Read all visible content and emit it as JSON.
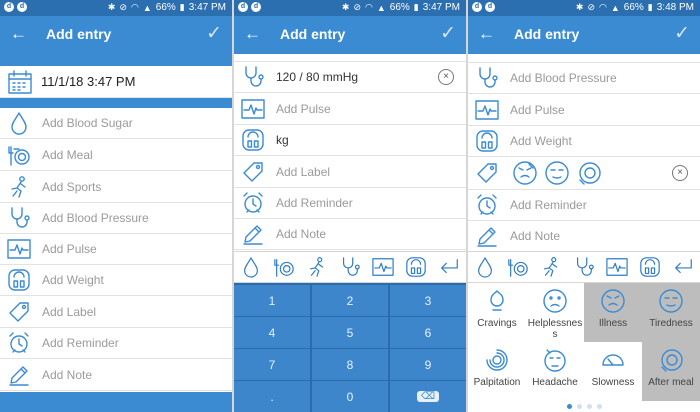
{
  "status": {
    "left_icons": [
      "d",
      "d"
    ],
    "screens": [
      {
        "battery": "66%",
        "time": "3:47 PM"
      },
      {
        "battery": "66%",
        "time": "3:47 PM"
      },
      {
        "battery": "66%",
        "time": "3:48 PM"
      }
    ]
  },
  "appbar": {
    "title": "Add entry",
    "back": "←",
    "confirm": "✓"
  },
  "screen1": {
    "date": "11/1/18 3:47 PM",
    "items": [
      {
        "label": "Add Blood Sugar",
        "icon": "drop-icon"
      },
      {
        "label": "Add Meal",
        "icon": "meal-icon"
      },
      {
        "label": "Add Sports",
        "icon": "sports-icon"
      },
      {
        "label": "Add Blood Pressure",
        "icon": "stethoscope-icon"
      },
      {
        "label": "Add Pulse",
        "icon": "pulse-icon"
      },
      {
        "label": "Add Weight",
        "icon": "weight-icon"
      },
      {
        "label": "Add Label",
        "icon": "tag-icon"
      },
      {
        "label": "Add Reminder",
        "icon": "alarm-icon"
      },
      {
        "label": "Add Note",
        "icon": "pencil-icon"
      }
    ]
  },
  "screen2": {
    "blood_pressure_value": "120 / 80 mmHg",
    "clear": "×",
    "pulse_label": "Add Pulse",
    "weight_unit": "kg",
    "label_label": "Add Label",
    "reminder_label": "Add Reminder",
    "note_label": "Add Note",
    "keys": [
      "1",
      "2",
      "3",
      "4",
      "5",
      "6",
      "7",
      "8",
      "9",
      ".",
      "0",
      "⌫"
    ]
  },
  "screen3": {
    "blood_pressure_label": "Add Blood Pressure",
    "pulse_label": "Add Pulse",
    "weight_label": "Add Weight",
    "clear": "×",
    "reminder_label": "Add Reminder",
    "note_label": "Add Note",
    "moods": [
      {
        "label": "Cravings",
        "selected": false
      },
      {
        "label": "Helplessness",
        "selected": false
      },
      {
        "label": "Illness",
        "selected": true
      },
      {
        "label": "Tiredness",
        "selected": true
      },
      {
        "label": "Palpitation",
        "selected": false
      },
      {
        "label": "Headache",
        "selected": false
      },
      {
        "label": "Slowness",
        "selected": false
      },
      {
        "label": "After meal",
        "selected": true
      }
    ],
    "pager_pages": 4,
    "pager_active": 0
  },
  "colors": {
    "appbar": "#3b8bd3",
    "statusbar": "#2c6fb0",
    "keypad": "#2a6cab",
    "key": "#3e86cc",
    "selected_mood": "#bdbdbd"
  }
}
